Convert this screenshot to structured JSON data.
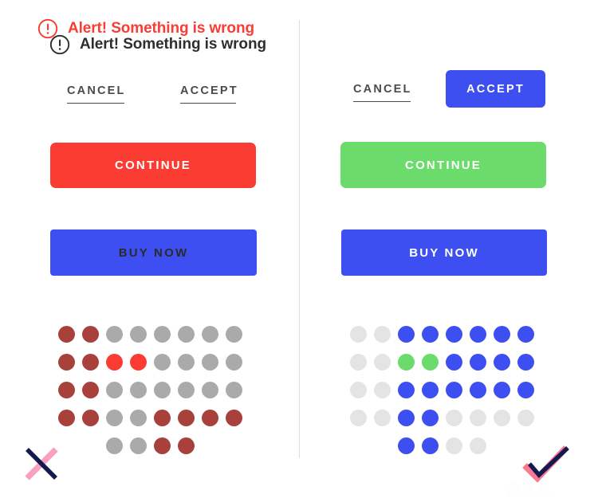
{
  "meta": {
    "background_color": "#ffffff",
    "divider_color": "#dedede"
  },
  "colors": {
    "red": "#fa3c32",
    "dark_red": "#a8403c",
    "blue": "#3d4ff0",
    "green": "#6bdc6b",
    "gray_mid": "#aaaaaa",
    "gray_light": "#e4e4e4",
    "text_dark": "#2e2e2e",
    "link_gray": "#4a4a4a",
    "pink": "#f9a0c0",
    "navy": "#141a50"
  },
  "left_panel": {
    "alert": {
      "icon": "alert-circle-exclamation-icon",
      "icon_color": "#2e2e2e",
      "text": "Alert! Something is wrong",
      "text_color": "#2e2e2e"
    },
    "cancel_label": "CANCEL",
    "accept_label": "ACCEPT",
    "continue_label": "CONTINUE",
    "buy_label": "BUY NOW"
  },
  "right_panel": {
    "alert": {
      "icon": "alert-circle-exclamation-icon",
      "icon_color": "#fa3c32",
      "text": "Alert! Something is wrong",
      "text_color": "#fa3c32"
    },
    "cancel_label": "CANCEL",
    "accept_label": "ACCEPT",
    "continue_label": "CONTINUE",
    "buy_label": "BUY NOW"
  },
  "chart_data": {
    "type": "heatmap",
    "title": "",
    "xlabel": "",
    "ylabel": "",
    "grid": false,
    "legend": "none",
    "note": "Two 8-column x 5-row dot matrices acting as color-swatch grids; value = swatch color key",
    "columns": 8,
    "rows": 5,
    "color_keys": {
      "dr": "#a8403c",
      "g": "#aaaaaa",
      "r": "#fa3c32",
      "b": "#3d4ff0",
      "gn": "#6bdc6b",
      "lg": "#e4e4e4",
      "x": "none"
    },
    "matrices": [
      {
        "name": "left-dot-grid",
        "cells": [
          [
            "dr",
            "dr",
            "g",
            "g",
            "g",
            "g",
            "g",
            "g"
          ],
          [
            "dr",
            "dr",
            "r",
            "r",
            "g",
            "g",
            "g",
            "g"
          ],
          [
            "dr",
            "dr",
            "g",
            "g",
            "g",
            "g",
            "g",
            "g"
          ],
          [
            "dr",
            "dr",
            "g",
            "g",
            "dr",
            "dr",
            "dr",
            "dr"
          ],
          [
            "x",
            "x",
            "g",
            "g",
            "dr",
            "dr",
            "x",
            "x"
          ]
        ]
      },
      {
        "name": "right-dot-grid",
        "cells": [
          [
            "lg",
            "lg",
            "b",
            "b",
            "b",
            "b",
            "b",
            "b"
          ],
          [
            "lg",
            "lg",
            "gn",
            "gn",
            "b",
            "b",
            "b",
            "b"
          ],
          [
            "lg",
            "lg",
            "b",
            "b",
            "b",
            "b",
            "b",
            "b"
          ],
          [
            "lg",
            "lg",
            "b",
            "b",
            "lg",
            "lg",
            "lg",
            "lg"
          ],
          [
            "x",
            "x",
            "b",
            "b",
            "lg",
            "lg",
            "x",
            "x"
          ]
        ]
      }
    ]
  },
  "marks": {
    "x_mark": {
      "name": "x-mark-icon",
      "stroke_back": "#f9a0c0",
      "stroke_front": "#141a50"
    },
    "check_mark": {
      "name": "check-mark-icon",
      "stroke_back": "#f9798f",
      "stroke_front": "#141a50"
    }
  },
  "watermark": {
    "latin": "AAA",
    "cjk": "教育"
  }
}
